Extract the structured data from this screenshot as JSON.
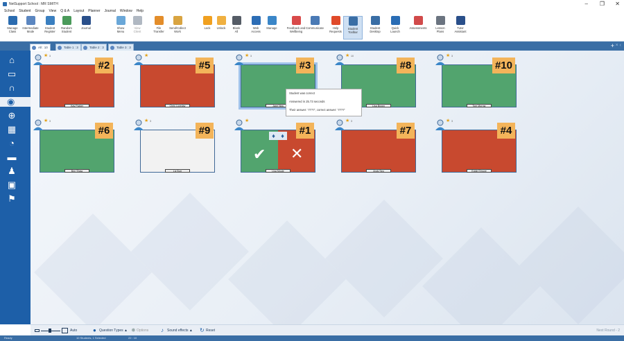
{
  "window": {
    "title": "NetSupport School : MR SMITH",
    "min": "–",
    "max": "❐",
    "close": "✕"
  },
  "menu": [
    "School",
    "Student",
    "Group",
    "View",
    "Q & A",
    "Layout",
    "Planner",
    "Journal",
    "Window",
    "Help"
  ],
  "ribbon": [
    {
      "label": "Manage\nClass",
      "icon": "manage-class-icon",
      "color": "#2b6cb0"
    },
    {
      "label": "Intermediate\nMode",
      "icon": "mode-icon",
      "color": "#5b86c0"
    },
    {
      "label": "Student\nRegister",
      "icon": "register-icon",
      "color": "#3a7fc0"
    },
    {
      "label": "Random\nStudent",
      "icon": "random-student-icon",
      "color": "#4a9a5a"
    },
    {
      "label": "Journal",
      "icon": "journal-icon",
      "color": "#2a4f8a"
    },
    {
      "label": "Show\nMenu",
      "icon": "show-icon",
      "color": "#6aa7d8"
    },
    {
      "label": "View\nClient",
      "icon": "view-client-icon",
      "color": "#b0b8c2",
      "disabled": true
    },
    {
      "label": "File\nTransfer",
      "icon": "file-transfer-icon",
      "color": "#e38d2a"
    },
    {
      "label": "Send/Collect\nWork",
      "icon": "send-collect-icon",
      "color": "#d9a441"
    },
    {
      "label": "Lock",
      "icon": "lock-icon",
      "color": "#f0a020"
    },
    {
      "label": "Unlock",
      "icon": "unlock-icon",
      "color": "#f0b040"
    },
    {
      "label": "Blank\nAll",
      "icon": "blank-icon",
      "color": "#555c66"
    },
    {
      "label": "Web\nAccess",
      "icon": "web-icon",
      "color": "#2d6db5"
    },
    {
      "label": "Manage",
      "icon": "manage-icon",
      "color": "#3a86c8"
    },
    {
      "label": "Feedback and\nWellbeing",
      "icon": "feedback-icon",
      "color": "#d94a4a"
    },
    {
      "label": "Communicate",
      "icon": "communicate-icon",
      "color": "#4a7ab5"
    },
    {
      "label": "Help\nRequests",
      "icon": "help-icon",
      "color": "#e04a2a"
    },
    {
      "label": "Student\nToolbar",
      "icon": "toolbar-icon",
      "color": "#3a6ea5",
      "active": true
    },
    {
      "label": "Student\nDesktop",
      "icon": "desktop-icon",
      "color": "#3a6ea5"
    },
    {
      "label": "Quick\nLaunch",
      "icon": "quick-launch-icon",
      "color": "#2a6db5"
    },
    {
      "label": "Assessments",
      "icon": "assessments-icon",
      "color": "#d14a4a"
    },
    {
      "label": "Lesson\nPlans",
      "icon": "lesson-plans-icon",
      "color": "#6b7480"
    },
    {
      "label": "Tutor\nAssistant",
      "icon": "tutor-assistant-icon",
      "color": "#2a4f8a"
    }
  ],
  "tabs": [
    {
      "label": "All : 10",
      "selected": true
    },
    {
      "label": "Table 1 : 3",
      "selected": false
    },
    {
      "label": "Table 2 : 3",
      "selected": false
    },
    {
      "label": "Table 3 : 3",
      "selected": false
    }
  ],
  "tabbar": {
    "plus": "+",
    "close": "× ‹"
  },
  "leftbar": [
    "home-icon",
    "monitor-icon",
    "headphones-icon",
    "qa-icon",
    "globe-icon",
    "grid-icon",
    "clock-icon",
    "printer-icon",
    "users-icon",
    "apps-icon",
    "chart-icon"
  ],
  "leftbar_glyphs": [
    "⌂",
    "▭",
    "∩",
    "◉",
    "⊕",
    "▦",
    "◔",
    "▬",
    "♟",
    "▣",
    "⚑"
  ],
  "students": [
    {
      "name": "Kay Parker",
      "rank": "#2",
      "color": "#c8492f",
      "sub": "3"
    },
    {
      "name": "Chris Loveday",
      "rank": "#5",
      "color": "#c8492f",
      "sub": ""
    },
    {
      "name": "Jane Nea",
      "rank": "#3",
      "color": "#52a46e",
      "sub": "3",
      "selected": true
    },
    {
      "name": "Lisa Brown",
      "rank": "#8",
      "color": "#52a46e",
      "sub": "10"
    },
    {
      "name": "Tom Murray",
      "rank": "#10",
      "color": "#52a46e",
      "sub": "3"
    },
    {
      "name": "Ben Shaw",
      "rank": "#6",
      "color": "#52a46e",
      "sub": "3"
    },
    {
      "name": "Liz Burr",
      "rank": "#9",
      "color": "#f2f2f2",
      "sub": "3"
    },
    {
      "name": "Lisa Moule",
      "rank": "#1",
      "color": "split",
      "sub": ""
    },
    {
      "name": "Andy Seo",
      "rank": "#7",
      "color": "#c8492f",
      "sub": "3"
    },
    {
      "name": "Eddie Elmore",
      "rank": "#4",
      "color": "#c8492f",
      "sub": "3"
    }
  ],
  "tooltip": {
    "line1": "Student was correct",
    "line2": "Answered in 25.73 seconds",
    "line3": "Their answer: '7777', correct answer: '7777'"
  },
  "statusbar": {
    "auto": "Auto",
    "question_types": "Question Types ▲",
    "options": "Options",
    "sound": "Sound effects ▲",
    "reset": "Reset",
    "next": "Next Round - 2"
  },
  "bottombar": {
    "left": "Ready",
    "mid1": "10 Students, 1 Selected",
    "mid2": "22 : 10"
  }
}
